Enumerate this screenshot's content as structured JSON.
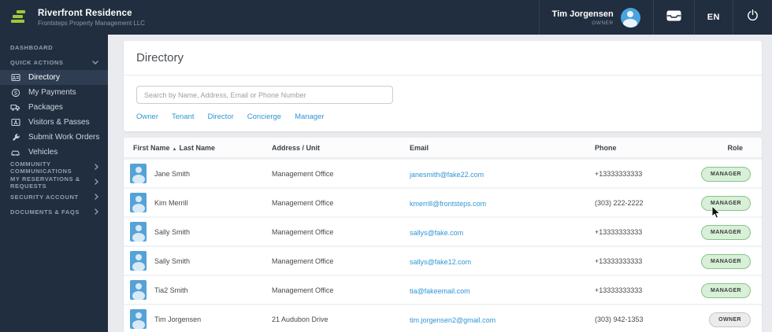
{
  "brand": {
    "community_name": "Riverfront Residence",
    "company_name": "Frontsteps Property Management LLC",
    "logo_color": "#9dc73b"
  },
  "topbar": {
    "user_name": "Tim Jorgensen",
    "user_role": "OWNER",
    "language": "EN",
    "icons": [
      "avatar-icon",
      "inbox-icon",
      "power-icon"
    ]
  },
  "sidebar": {
    "dashboard_label": "DASHBOARD",
    "quick_actions_label": "QUICK ACTIONS",
    "quick_actions_items": [
      {
        "label": "Directory",
        "icon": "contact-card-icon",
        "active": true
      },
      {
        "label": "My Payments",
        "icon": "dollar-circle-icon",
        "active": false
      },
      {
        "label": "Packages",
        "icon": "truck-icon",
        "active": false
      },
      {
        "label": "Visitors & Passes",
        "icon": "id-card-icon",
        "active": false
      },
      {
        "label": "Submit Work Orders",
        "icon": "wrench-icon",
        "active": false
      },
      {
        "label": "Vehicles",
        "icon": "car-icon",
        "active": false
      }
    ],
    "collapsed_sections": [
      "COMMUNITY COMMUNICATIONS",
      "MY RESERVATIONS & REQUESTS",
      "SECURITY ACCOUNT",
      "DOCUMENTS & FAQS"
    ],
    "bg_color": "#212e3f"
  },
  "directory": {
    "title": "Directory",
    "search_placeholder": "Search by Name, Address, Email or Phone Number",
    "filters": [
      "Owner",
      "Tenant",
      "Director",
      "Concierge",
      "Manager"
    ],
    "table": {
      "headers": {
        "first_name": "First Name",
        "last_name": "Last Name",
        "address": "Address / Unit",
        "email": "Email",
        "phone": "Phone",
        "role": "Role"
      },
      "sort": "first_name ascending",
      "rows": [
        {
          "name": "Jane Smith",
          "address": "Management Office",
          "email": "janesmith@fake22.com",
          "phone": "+13333333333",
          "role": "MANAGER"
        },
        {
          "name": "Kim Merrill",
          "address": "Management Office",
          "email": "kmerrill@frontsteps.com",
          "phone": "(303) 222-2222",
          "role": "MANAGER"
        },
        {
          "name": "Sally Smith",
          "address": "Management Office",
          "email": "sallys@fake.com",
          "phone": "+13333333333",
          "role": "MANAGER"
        },
        {
          "name": "Sally Smith",
          "address": "Management Office",
          "email": "sallys@fake12.com",
          "phone": "+13333333333",
          "role": "MANAGER"
        },
        {
          "name": "Tia2 Smith",
          "address": "Management Office",
          "email": "tia@fakeemail.com",
          "phone": "+13333333333",
          "role": "MANAGER"
        },
        {
          "name": "Tim Jorgensen",
          "address": "21 Audubon Drive",
          "email": "tim.jorgensen2@gmail.com",
          "phone": "(303) 942-1353",
          "role": "OWNER"
        }
      ]
    },
    "colors": {
      "link_blue": "#3096d5",
      "manager_pill_bg": "#d8efd8",
      "manager_pill_border": "#86c586",
      "owner_pill_bg": "#ebebeb",
      "owner_pill_border": "#c6c6c6"
    }
  }
}
